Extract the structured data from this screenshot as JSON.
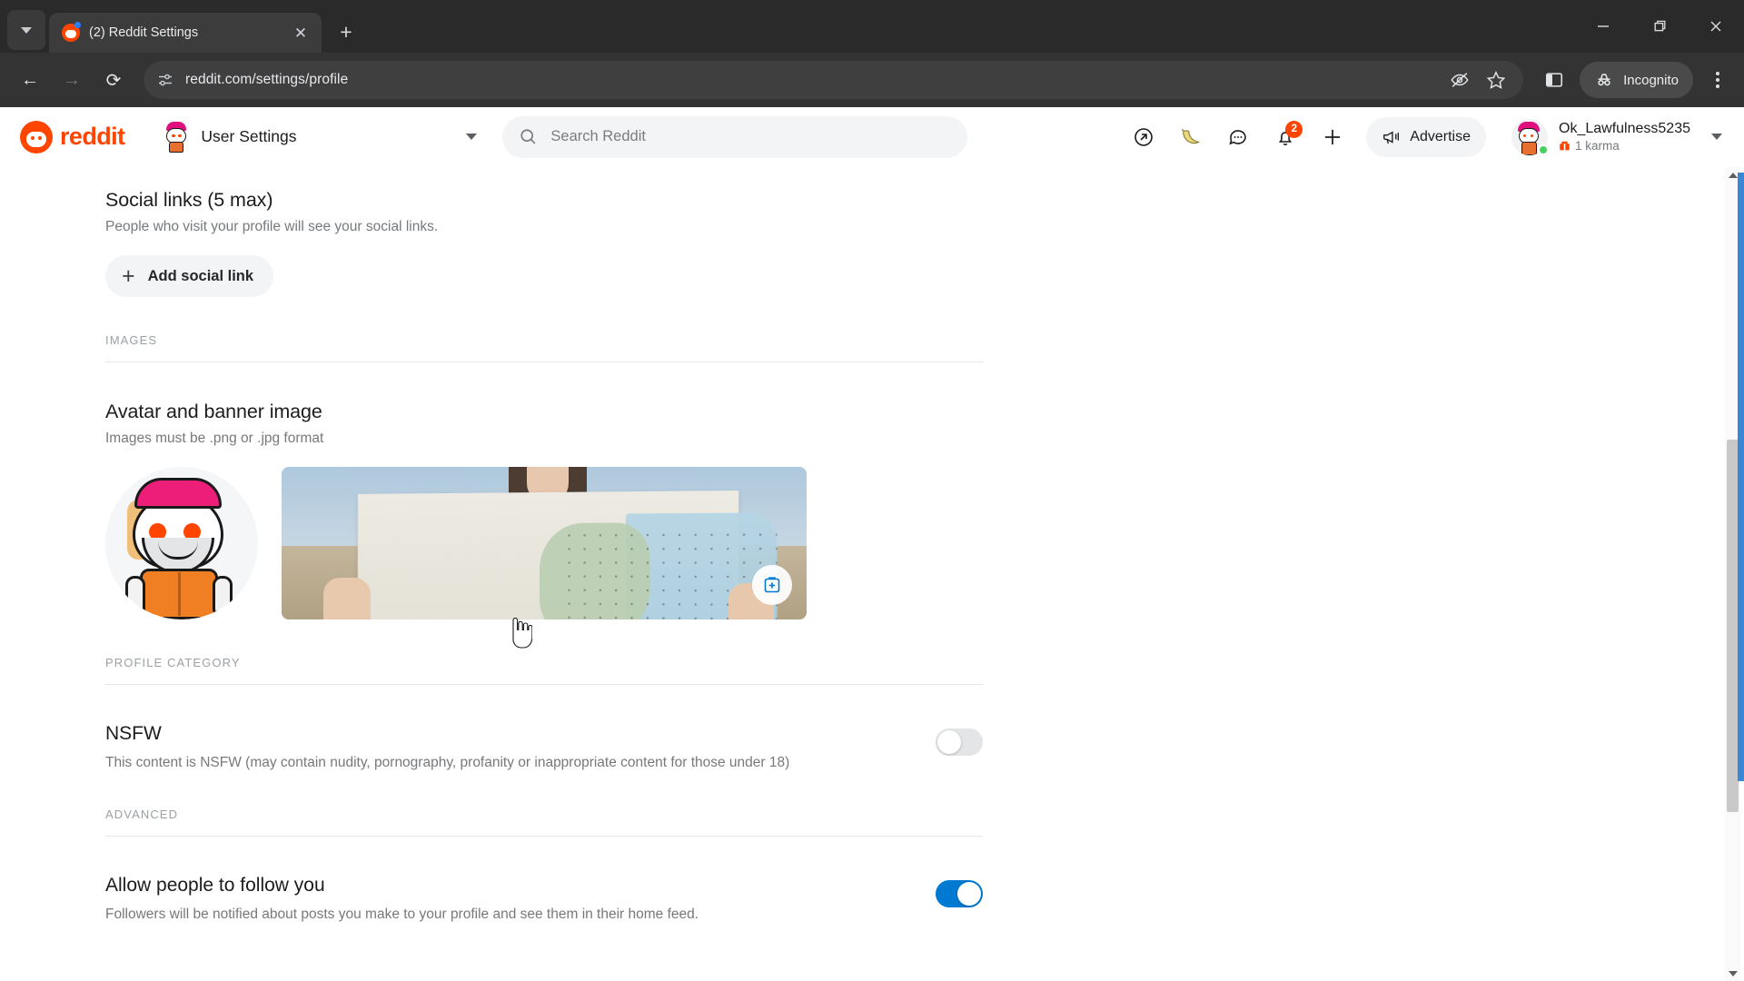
{
  "browser": {
    "tab": {
      "title": "(2) Reddit Settings",
      "favicon": "reddit-favicon",
      "close_label": "✕"
    },
    "new_tab_label": "+",
    "tabstrip_menu": "tab-search-chevron",
    "window_controls": {
      "minimize": "—",
      "maximize": "❐",
      "close": "✕"
    },
    "nav": {
      "back": "←",
      "forward": "→",
      "reload": "⟳"
    },
    "address": {
      "url": "reddit.com/settings/profile",
      "site_icon": "site-settings-icon"
    },
    "toolbar_icons": [
      "eye-slash-icon",
      "star-icon",
      "side-panel-icon"
    ],
    "profile_pill": {
      "label": "Incognito",
      "icon": "incognito-icon"
    },
    "menu": "kebab-menu-icon"
  },
  "reddit_header": {
    "logo_text": "reddit",
    "settings_selector": {
      "label": "User Settings",
      "avatar": "snoo-avatar",
      "chevron": "chevron-down-icon"
    },
    "search": {
      "placeholder": "Search Reddit",
      "icon": "search-icon"
    },
    "action_icons": [
      {
        "name": "popular-arrow-icon"
      },
      {
        "name": "banana-icon"
      },
      {
        "name": "chat-bubble-icon"
      },
      {
        "name": "notification-bell-icon",
        "badge": "2"
      },
      {
        "name": "create-post-plus-icon"
      }
    ],
    "advertise": {
      "label": "Advertise",
      "icon": "megaphone-icon"
    },
    "user": {
      "username": "Ok_Lawfulness5235",
      "karma": "1 karma",
      "karma_icon": "karma-icon",
      "status": "online",
      "chevron": "chevron-down-icon"
    }
  },
  "settings": {
    "social_links": {
      "title": "Social links (5 max)",
      "description": "People who visit your profile will see your social links.",
      "add_button": "Add social link",
      "add_icon": "plus-icon"
    },
    "groups": {
      "images": "IMAGES",
      "profile_category": "PROFILE CATEGORY",
      "advanced": "ADVANCED"
    },
    "avatar_banner": {
      "title": "Avatar and banner image",
      "description": "Images must be .png or .jpg format",
      "avatar_alt": "user-avatar-snoo",
      "banner_alt": "banner-photo-person-holding-map",
      "edit_icon": "add-image-icon"
    },
    "nsfw": {
      "title": "NSFW",
      "description": "This content is NSFW (may contain nudity, pornography, profanity or inappropriate content for those under 18)",
      "enabled": false
    },
    "follow": {
      "title": "Allow people to follow you",
      "description": "Followers will be notified about posts you make to your profile and see them in their home feed.",
      "enabled": true
    }
  },
  "colors": {
    "reddit_orange": "#ff4500",
    "toggle_on": "#0079d3",
    "badge": "#ff4500",
    "chrome_dark": "#333333"
  },
  "scrollbar": {
    "up_arrow": "▲",
    "down_arrow": "▼"
  }
}
